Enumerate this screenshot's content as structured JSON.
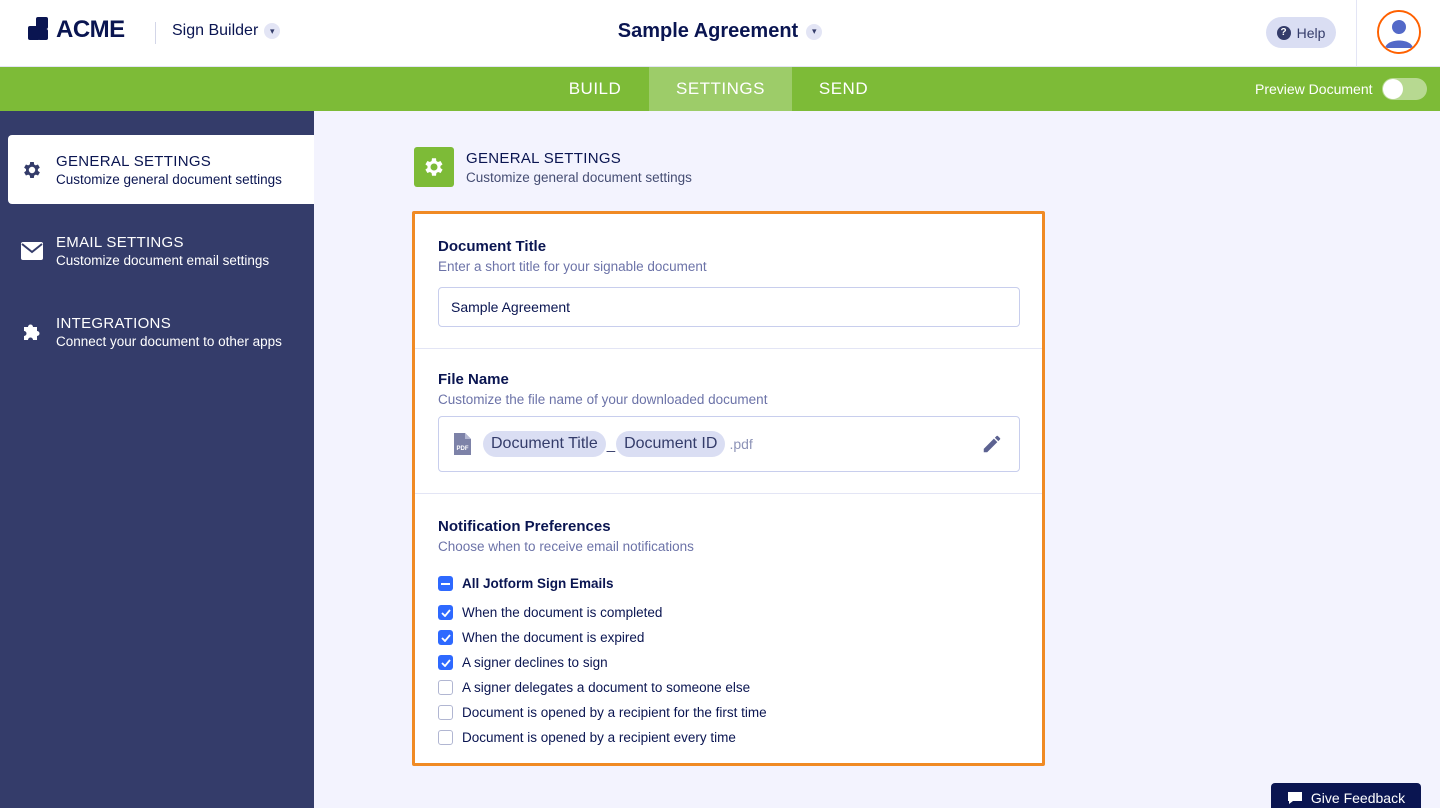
{
  "header": {
    "logo_text": "ACME",
    "app_switcher_label": "Sign Builder",
    "document_title": "Sample Agreement",
    "help_label": "Help"
  },
  "nav": {
    "tabs": [
      {
        "label": "BUILD"
      },
      {
        "label": "SETTINGS"
      },
      {
        "label": "SEND"
      }
    ],
    "active_tab": "SETTINGS",
    "preview_label": "Preview Document"
  },
  "sidebar": {
    "items": [
      {
        "title": "GENERAL SETTINGS",
        "subtitle": "Customize general document settings"
      },
      {
        "title": "EMAIL SETTINGS",
        "subtitle": "Customize document email settings"
      },
      {
        "title": "INTEGRATIONS",
        "subtitle": "Connect your document to other apps"
      }
    ]
  },
  "section": {
    "title": "GENERAL SETTINGS",
    "subtitle": "Customize general document settings"
  },
  "document_title": {
    "label": "Document Title",
    "help": "Enter a short title for your signable document",
    "value": "Sample Agreement"
  },
  "file_name": {
    "label": "File Name",
    "help": "Customize the file name of your downloaded document",
    "token1": "Document Title",
    "separator": "_",
    "token2": "Document ID",
    "extension": ".pdf",
    "file_icon_text": "PDF"
  },
  "notifications": {
    "label": "Notification Preferences",
    "help": "Choose when to receive email notifications",
    "all_label": "All Jotform Sign Emails",
    "options": [
      {
        "label": "When the document is completed",
        "checked": true
      },
      {
        "label": "When the document is expired",
        "checked": true
      },
      {
        "label": "A signer declines to sign",
        "checked": true
      },
      {
        "label": "A signer delegates a document to someone else",
        "checked": false
      },
      {
        "label": "Document is opened by a recipient for the first time",
        "checked": false
      },
      {
        "label": "Document is opened by a recipient every time",
        "checked": false
      }
    ]
  },
  "feedback_label": "Give Feedback",
  "colors": {
    "accent_green": "#7dbb37",
    "navy": "#0a1551",
    "sidebar_bg": "#343c6a",
    "highlight_orange": "#f08a24",
    "checkbox_blue": "#2e69ff"
  }
}
